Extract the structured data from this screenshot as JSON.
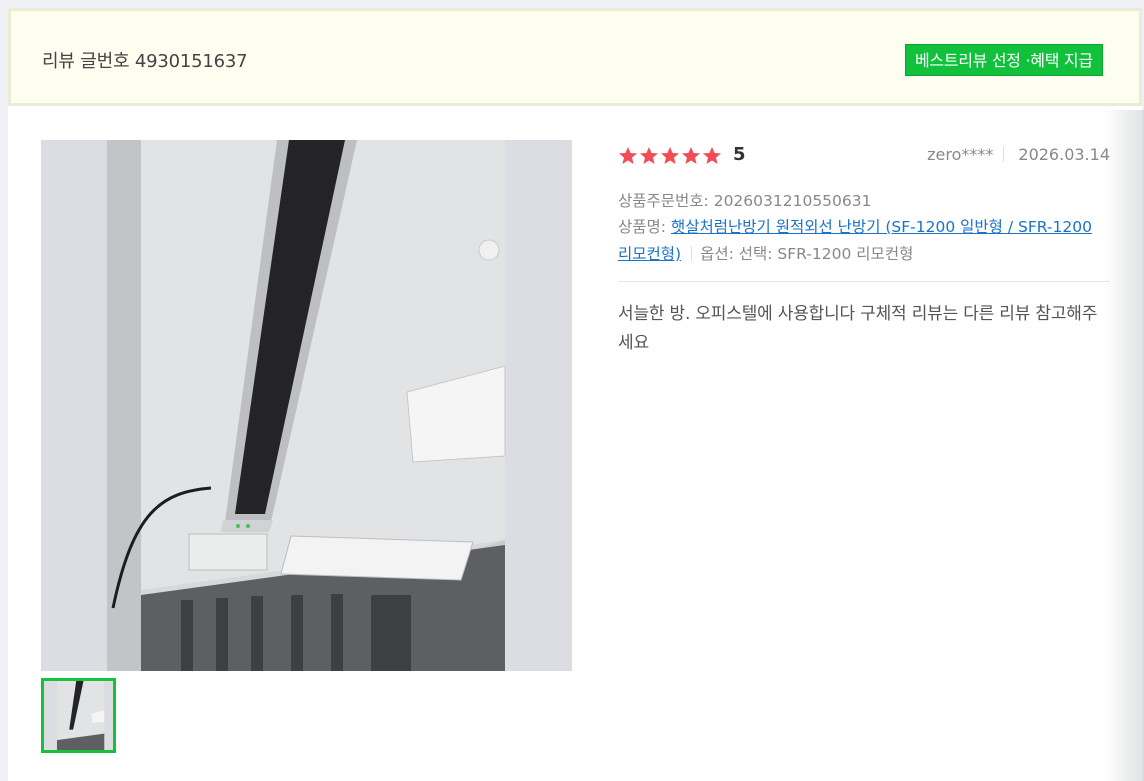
{
  "header": {
    "title": "리뷰 글번호 4930151637",
    "badge": "베스트리뷰 선정 ·혜택 지급"
  },
  "review": {
    "rating": 5,
    "rating_display": "5",
    "star_count": 5,
    "author": "zero****",
    "date": "2026.03.14",
    "order_label": "상품주문번호: 2026031210550631",
    "product_label": "상품명:",
    "product_name": "햇살처럼난방기 원적외선 난방기 (SF-1200 일반형 / SFR-1200 리모컨형)",
    "option_label": "옵션: 선택: SFR-1200 리모컨형",
    "text": "서늘한 방. 오피스텔에 사용합니다 구체적 리뷰는 다른 리뷰 참고해주세요"
  },
  "colors": {
    "star": "#f24d57",
    "badge": "#11c13c",
    "link": "#1a73c8",
    "thumb_border": "#16c23b"
  },
  "icons": {
    "star": "star-icon"
  }
}
